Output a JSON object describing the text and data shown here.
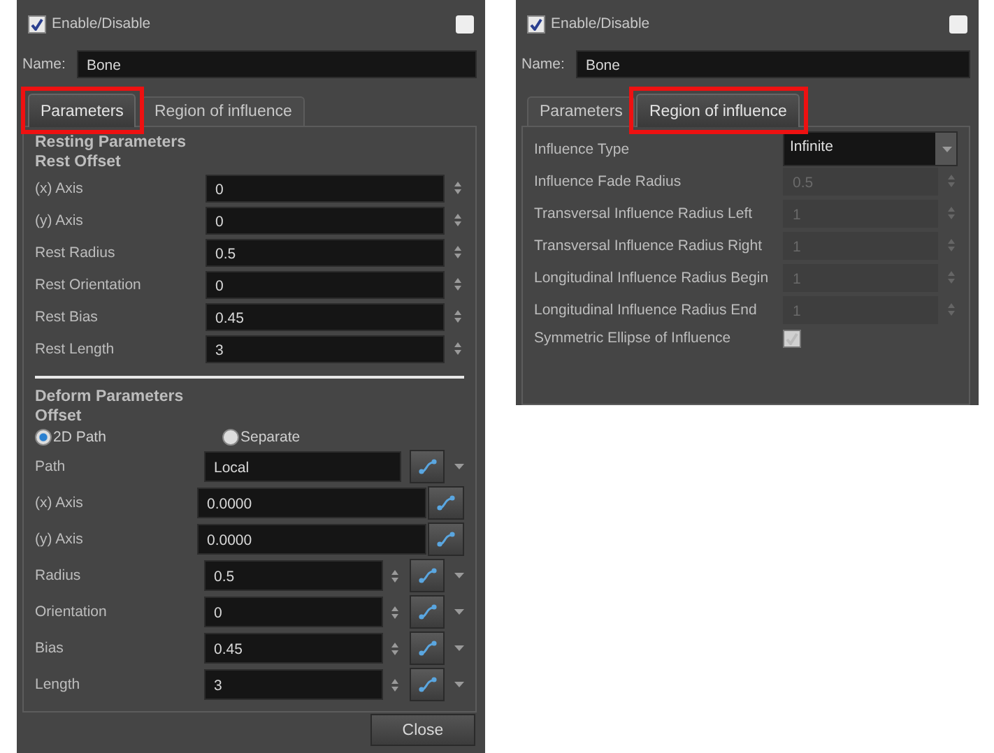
{
  "panels": [
    {
      "enable": {
        "label": "Enable/Disable",
        "checked": true
      },
      "name": {
        "label": "Name:",
        "value": "Bone"
      },
      "tabs": [
        {
          "label": "Parameters",
          "selected": true,
          "callout": true
        },
        {
          "label": "Region of influence",
          "selected": false,
          "callout": false
        }
      ],
      "rows": [
        {
          "kind": "heading",
          "text": "Resting Parameters"
        },
        {
          "kind": "heading",
          "text": "Rest Offset"
        },
        {
          "kind": "spin",
          "label": "(x) Axis",
          "value": "0",
          "disabled": false
        },
        {
          "kind": "spin",
          "label": "(y) Axis",
          "value": "0",
          "disabled": false
        },
        {
          "kind": "spin",
          "label": "Rest Radius",
          "value": "0.5",
          "disabled": false
        },
        {
          "kind": "spin",
          "label": "Rest Orientation",
          "value": "0",
          "disabled": false
        },
        {
          "kind": "spin",
          "label": "Rest Bias",
          "value": "0.45",
          "disabled": false
        },
        {
          "kind": "spin",
          "label": "Rest Length",
          "value": "3",
          "disabled": false
        },
        {
          "kind": "rule"
        },
        {
          "kind": "heading",
          "text": "Deform Parameters"
        },
        {
          "kind": "heading",
          "text": "Offset"
        },
        {
          "kind": "radio",
          "options": [
            {
              "label": "2D Path",
              "selected": true
            },
            {
              "label": "Separate",
              "selected": false
            }
          ]
        },
        {
          "kind": "function",
          "label": "Path",
          "value": "Local",
          "spinner": false,
          "menu": true
        },
        {
          "kind": "function",
          "label": "(x) Axis",
          "value": "0.0000",
          "spinner": false,
          "menu": false
        },
        {
          "kind": "function",
          "label": "(y) Axis",
          "value": "0.0000",
          "spinner": false,
          "menu": false
        },
        {
          "kind": "function",
          "label": "Radius",
          "value": "0.5",
          "spinner": true,
          "menu": true
        },
        {
          "kind": "function",
          "label": "Orientation",
          "value": "0",
          "spinner": true,
          "menu": true
        },
        {
          "kind": "function",
          "label": "Bias",
          "value": "0.45",
          "spinner": true,
          "menu": true
        },
        {
          "kind": "function",
          "label": "Length",
          "value": "3",
          "spinner": true,
          "menu": true
        }
      ],
      "buttons": [
        "Close"
      ]
    },
    {
      "enable": {
        "label": "Enable/Disable",
        "checked": true
      },
      "name": {
        "label": "Name:",
        "value": "Bone"
      },
      "tabs": [
        {
          "label": "Parameters",
          "selected": false,
          "callout": false
        },
        {
          "label": "Region of influence",
          "selected": true,
          "callout": true
        }
      ],
      "rows": [
        {
          "kind": "combo",
          "label": "Influence Type",
          "value": "Infinite"
        },
        {
          "kind": "spin",
          "label": "Influence Fade Radius",
          "value": "0.5",
          "disabled": true
        },
        {
          "kind": "spin",
          "label": "Transversal Influence Radius Left",
          "value": "1",
          "disabled": true
        },
        {
          "kind": "spin",
          "label": "Transversal Influence Radius Right",
          "value": "1",
          "disabled": true
        },
        {
          "kind": "spin",
          "label": "Longitudinal Influence Radius Begin",
          "value": "1",
          "disabled": true
        },
        {
          "kind": "spin",
          "label": "Longitudinal Influence Radius End",
          "value": "1",
          "disabled": true
        },
        {
          "kind": "check",
          "label": "Symmetric Ellipse of Influence",
          "checked": true,
          "disabled": true
        }
      ]
    }
  ]
}
